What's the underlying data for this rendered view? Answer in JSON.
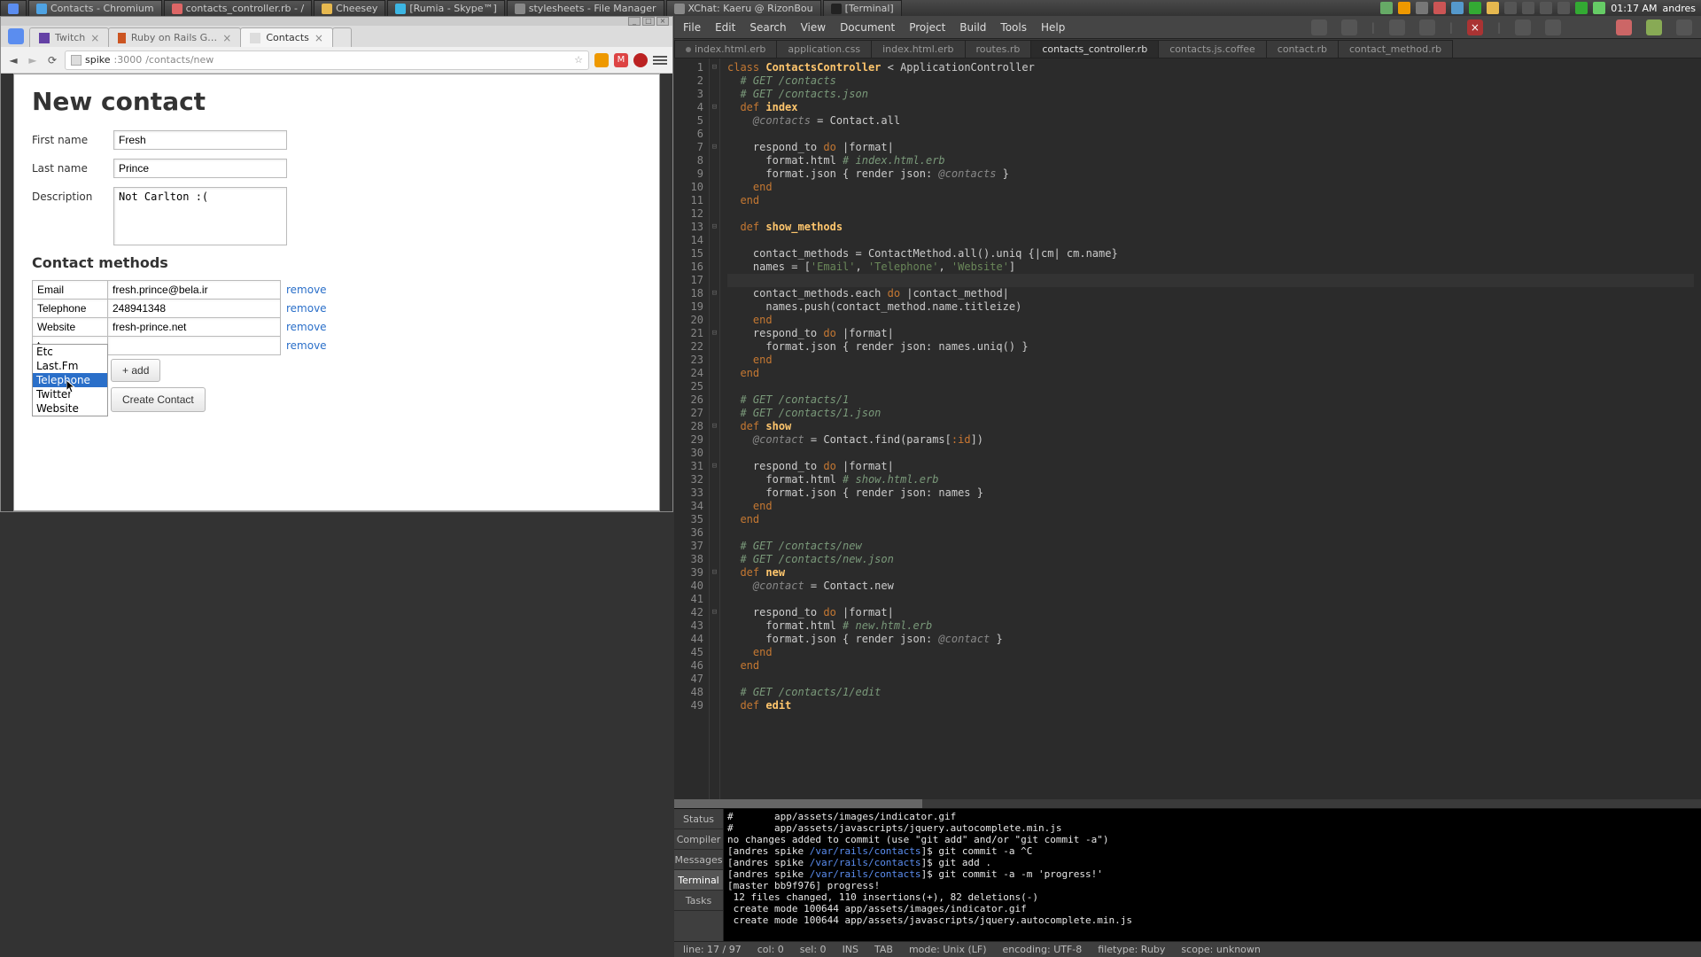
{
  "taskbar": {
    "items": [
      {
        "label": "Contacts - Chromium",
        "icon_color": "#4fa3e3"
      },
      {
        "label": "contacts_controller.rb - /",
        "icon_color": "#d66"
      },
      {
        "label": "Cheesey",
        "icon_color": "#e6b84f"
      },
      {
        "label": "[Rumia - Skype™]",
        "icon_color": "#3cb6e3"
      },
      {
        "label": "stylesheets - File Manager",
        "icon_color": "#888"
      },
      {
        "label": "XChat: Kaeru @ RizonBou",
        "icon_color": "#888"
      },
      {
        "label": "[Terminal]",
        "icon_color": "#222"
      }
    ],
    "clock": "01:17 AM",
    "user": "andres"
  },
  "browser": {
    "tabs": [
      {
        "label": "Twitch"
      },
      {
        "label": "Ruby on Rails Guides: Ge"
      },
      {
        "label": "Contacts"
      }
    ],
    "url": {
      "host": "spike",
      "port": ":3000",
      "path": "/contacts/new"
    }
  },
  "form": {
    "title": "New contact",
    "labels": {
      "first": "First name",
      "last": "Last name",
      "desc": "Description"
    },
    "values": {
      "first": "Fresh",
      "last": "Prince",
      "desc": "Not Carlton :("
    },
    "section": "Contact methods",
    "methods": [
      {
        "type": "Email",
        "value": "fresh.prince@bela.ir"
      },
      {
        "type": "Telephone",
        "value": "248941348"
      },
      {
        "type": "Website",
        "value": "fresh-prince.net"
      },
      {
        "type": "t",
        "value": ""
      }
    ],
    "remove": "remove",
    "add": "+ add",
    "submit": "Create Contact",
    "autocomplete": [
      "Etc",
      "Last.Fm",
      "Telephone",
      "Twitter",
      "Website"
    ],
    "autocomplete_selected": 2
  },
  "editor_menu": [
    "File",
    "Edit",
    "Search",
    "View",
    "Document",
    "Project",
    "Build",
    "Tools",
    "Help"
  ],
  "file_tabs": [
    {
      "label": "index.html.erb"
    },
    {
      "label": "application.css"
    },
    {
      "label": "index.html.erb"
    },
    {
      "label": "routes.rb"
    },
    {
      "label": "contacts_controller.rb",
      "active": true
    },
    {
      "label": "contacts.js.coffee"
    },
    {
      "label": "contact.rb"
    },
    {
      "label": "contact_method.rb"
    }
  ],
  "panel_tabs": [
    "Status",
    "Compiler",
    "Messages",
    "Terminal",
    "Tasks"
  ],
  "panel_active": 3,
  "terminal_lines": [
    "#       app/assets/images/indicator.gif",
    "#       app/assets/javascripts/jquery.autocomplete.min.js",
    "no changes added to commit (use \"git add\" and/or \"git commit -a\")",
    "[andres spike /var/rails/contacts]$ git commit -a ^C",
    "[andres spike /var/rails/contacts]$ git add .",
    "[andres spike /var/rails/contacts]$ git commit -a -m 'progress!'",
    "[master bb9f976] progress!",
    " 12 files changed, 110 insertions(+), 82 deletions(-)",
    " create mode 100644 app/assets/images/indicator.gif",
    " create mode 100644 app/assets/javascripts/jquery.autocomplete.min.js"
  ],
  "status_bar": {
    "pos": "line: 17 / 97",
    "col": "col: 0",
    "sel": "sel: 0",
    "ins": "INS",
    "tab": "TAB",
    "mode": "mode: Unix (LF)",
    "enc": "encoding: UTF-8",
    "ft": "filetype: Ruby",
    "scope": "scope: unknown"
  }
}
